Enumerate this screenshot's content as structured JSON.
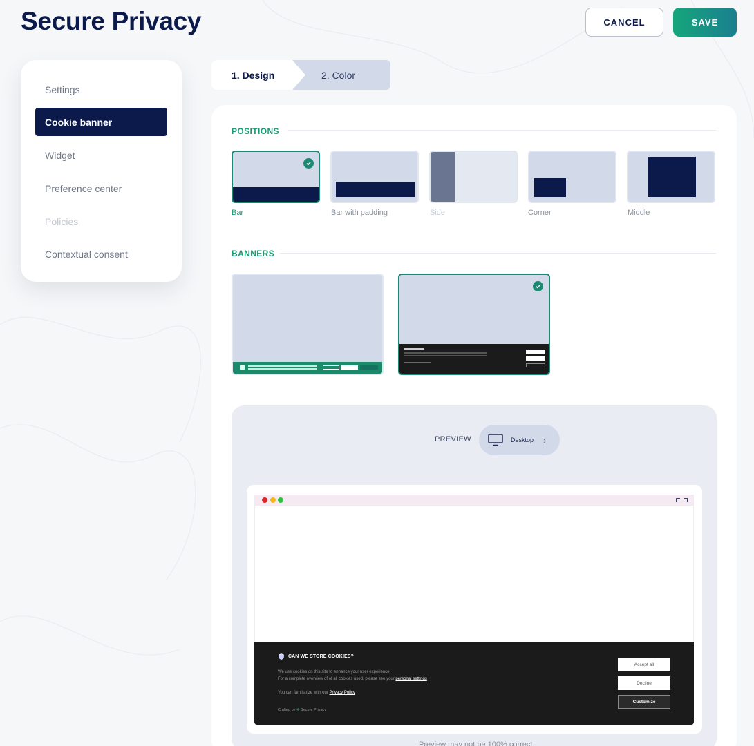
{
  "header": {
    "title": "Secure Privacy",
    "cancel_label": "CANCEL",
    "save_label": "SAVE"
  },
  "sidebar": {
    "items": [
      {
        "label": "Settings",
        "state": "default"
      },
      {
        "label": "Cookie banner",
        "state": "active"
      },
      {
        "label": "Widget",
        "state": "default"
      },
      {
        "label": "Preference center",
        "state": "default"
      },
      {
        "label": "Policies",
        "state": "disabled"
      },
      {
        "label": "Contextual consent",
        "state": "default"
      }
    ]
  },
  "steps": {
    "design": "1. Design",
    "color": "2. Color"
  },
  "positions": {
    "heading": "POSITIONS",
    "options": [
      {
        "label": "Bar",
        "selected": true
      },
      {
        "label": "Bar with padding",
        "selected": false
      },
      {
        "label": "Side",
        "selected": false,
        "disabled": true
      },
      {
        "label": "Corner",
        "selected": false
      },
      {
        "label": "Middle",
        "selected": false
      }
    ]
  },
  "banners": {
    "heading": "BANNERS",
    "options": [
      {
        "style": "green",
        "selected": false
      },
      {
        "style": "dark",
        "selected": true
      }
    ]
  },
  "preview": {
    "label": "PREVIEW",
    "device": "Desktop",
    "note": "Preview may not be 100% correct",
    "cookie_banner": {
      "title": "CAN WE STORE COOKIES?",
      "line1": "We use cookies on this site to enhance your user experience.",
      "line2_prefix": "For a complete overview of of all cookies used, please see your ",
      "line2_link": "personal settings",
      "line3_prefix": "You can familiarize with our ",
      "line3_link": "Privacy Policy",
      "credit_prefix": "Crafted by",
      "credit_brand": "Secure Privacy",
      "accept_label": "Accept all",
      "decline_label": "Decline",
      "customize_label": "Customize"
    }
  },
  "colors": {
    "navy": "#0c1a4b",
    "accent_green": "#1a9a73",
    "card_blue": "#d2daea",
    "banner_dark": "#1b1b1b",
    "banner_green": "#1a8a6a"
  }
}
